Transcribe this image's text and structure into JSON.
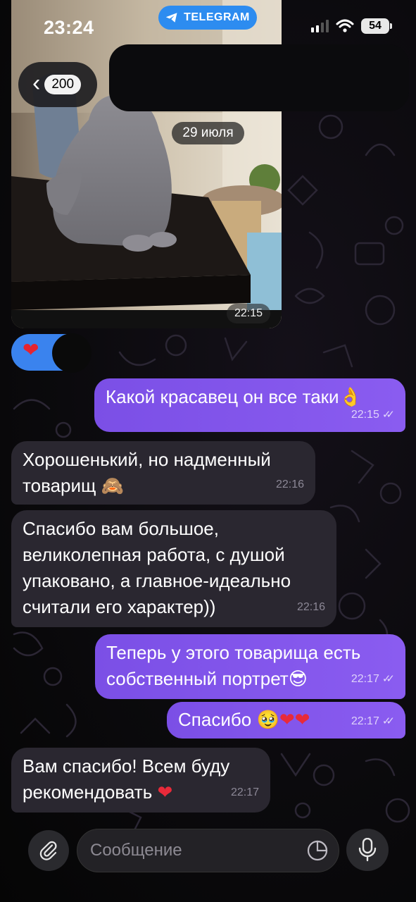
{
  "status_bar": {
    "time": "23:24",
    "app_pill": "TELEGRAM",
    "battery": "54"
  },
  "header": {
    "back_count": "200"
  },
  "media": {
    "date_badge": "29 июля",
    "time": "22:15"
  },
  "messages": [
    {
      "side": "out",
      "text": "Какой красавец он все таки",
      "emoji": "👌",
      "time": "22:15"
    },
    {
      "side": "in",
      "lines": [
        "Хорошенький, но надменный",
        "товарищ"
      ],
      "emoji": "🙈",
      "time": "22:16"
    },
    {
      "side": "in",
      "lines": [
        "Спасибо вам большое,",
        "великолепная работа, с душой",
        "упаковано, а главное-идеально",
        "считали его характер))"
      ],
      "time": "22:16"
    },
    {
      "side": "out",
      "lines": [
        "Теперь у этого товарища есть",
        "собственный портрет"
      ],
      "emoji": "😎",
      "time": "22:17"
    },
    {
      "side": "out",
      "text": "Спасибо",
      "emoji": "🥹",
      "time": "22:17"
    },
    {
      "side": "in",
      "lines": [
        "Вам спасибо! Всем буду",
        "рекомендовать"
      ],
      "time": "22:17"
    }
  ],
  "composer": {
    "placeholder": "Сообщение"
  },
  "colors": {
    "outgoing_bubble": "#8458ee",
    "incoming_bubble": "#2a2730",
    "telegram_pill": "#2d8cf0",
    "reaction_pill": "#3a83ee"
  },
  "icons": [
    "telegram-plane-icon",
    "signal-icon",
    "wifi-icon",
    "battery-icon",
    "chevron-left-icon",
    "heart-icon",
    "double-check-icon",
    "paperclip-icon",
    "sticker-icon",
    "microphone-icon"
  ]
}
